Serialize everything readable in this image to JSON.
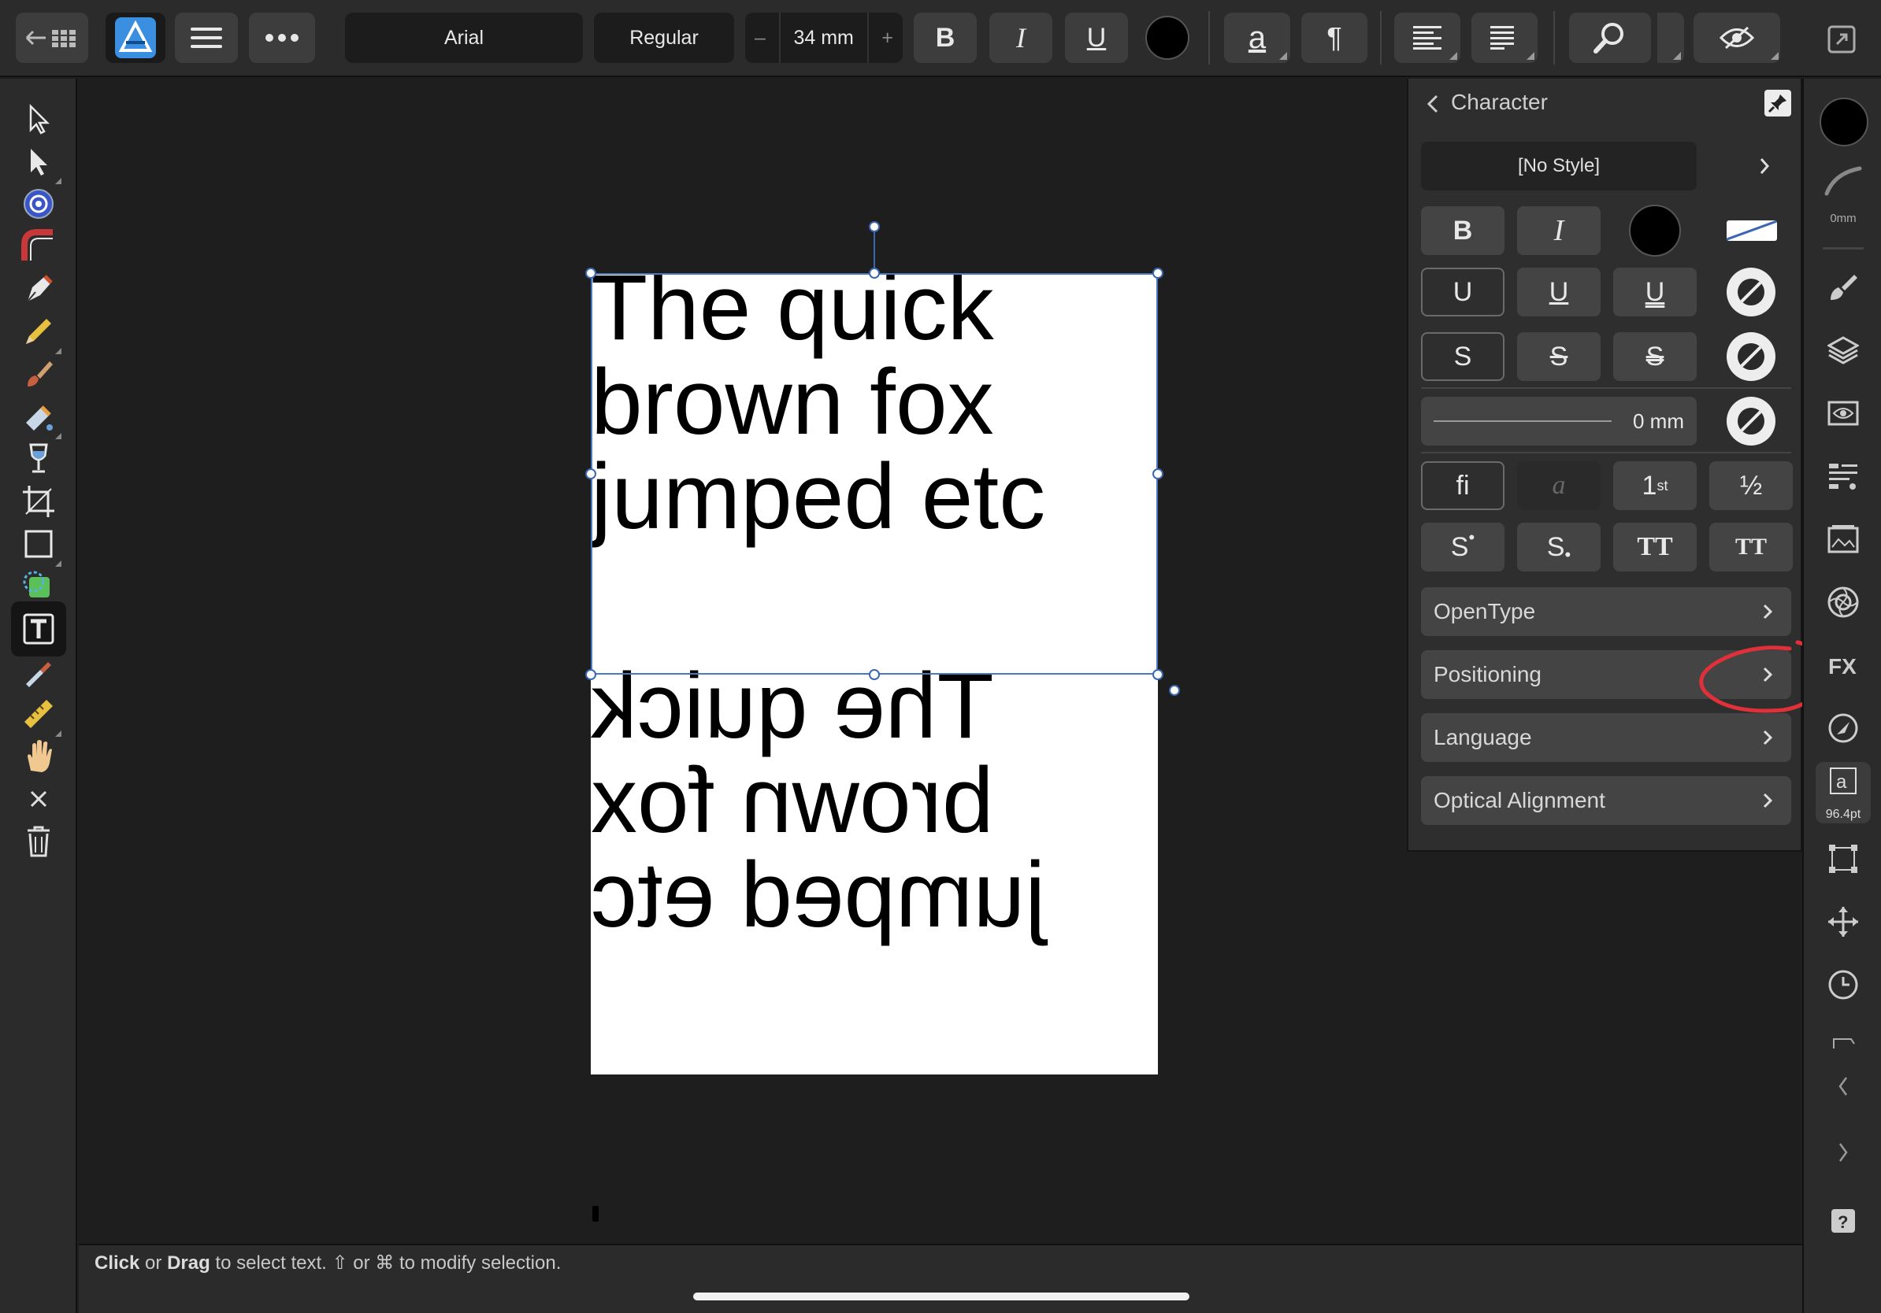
{
  "toolbar": {
    "font_family": "Arial",
    "font_style": "Regular",
    "font_size": "34 mm",
    "size_decrease": "–",
    "size_increase": "+",
    "bold_label": "B",
    "italic_label": "I",
    "underline_label": "U",
    "text_color": "#000000",
    "char_style_label": "a",
    "para_label": "¶"
  },
  "panel": {
    "title": "Character",
    "style_name": "[No Style]",
    "bold_label": "B",
    "italic_label": "I",
    "underline_labels": [
      "U",
      "U",
      "U"
    ],
    "strike_labels": [
      "S",
      "S",
      "S"
    ],
    "outline_value": "0 mm",
    "ligature_label": "fi",
    "alt_label": "a",
    "ordinal_label": "1",
    "ordinal_sup": "st",
    "fraction_label": "½",
    "superscript_label": "S",
    "subscript_label": "S",
    "allcaps_label": "TT",
    "smallcaps_label": "TT",
    "rows": [
      "OpenType",
      "Positioning",
      "Language",
      "Optical Alignment"
    ]
  },
  "canvas": {
    "text_lines": [
      "The quick",
      "brown fox",
      "jumped etc"
    ],
    "annotation_color": "#e0303a",
    "selection_color": "#4a78c0"
  },
  "rightrail": {
    "stroke_width": "0mm",
    "char_size": "96.4pt"
  },
  "status": {
    "click": "Click",
    "or1": " or ",
    "drag": "Drag",
    "rest": " to select text. ⇧ or ⌘ to modify selection."
  }
}
